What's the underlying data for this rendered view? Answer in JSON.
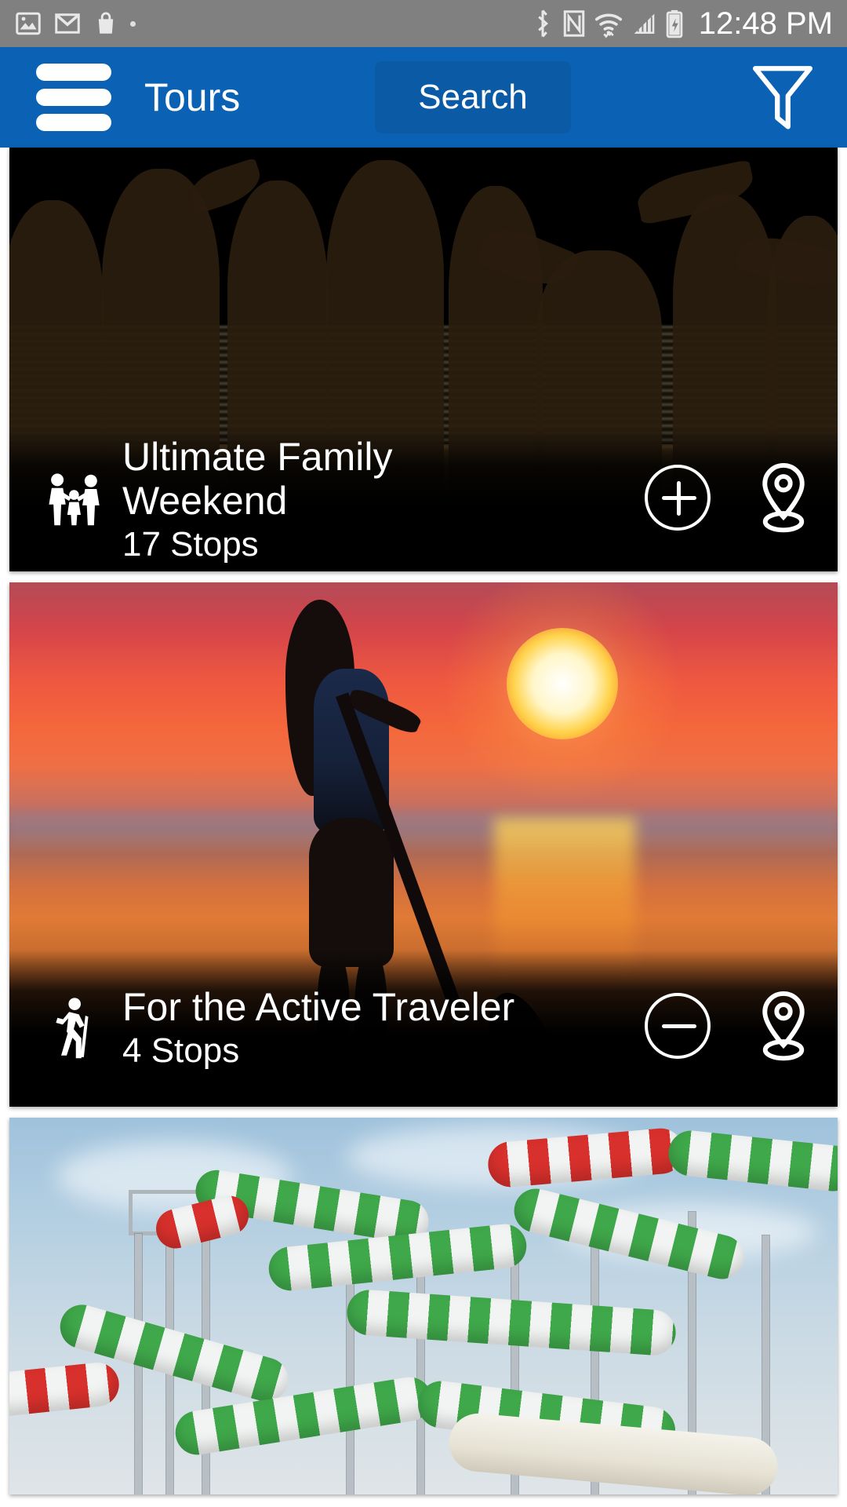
{
  "status_bar": {
    "background": "#808080",
    "left_icons": [
      "image-icon",
      "gmail-icon",
      "shopping-bag-icon",
      "dot-icon"
    ],
    "right_icons": [
      "bluetooth-icon",
      "nfc-icon",
      "wifi-icon",
      "cellular-signal-icon",
      "battery-charging-icon"
    ],
    "clock": "12:48 PM"
  },
  "header": {
    "background": "#0B62B5",
    "menu_icon": "hamburger-menu-icon",
    "title": "Tours",
    "search_label": "Search",
    "search_background": "#0A5AA6",
    "filter_icon": "funnel-filter-icon"
  },
  "cards": [
    {
      "title": "Ultimate Family Weekend",
      "stops": "17 Stops",
      "type_icon": "family-icon",
      "action_icon": "plus-circle-icon",
      "map_icon": "map-pin-icon",
      "photo": "beach-sunset-silhouettes-photo"
    },
    {
      "title": "For the Active Traveler",
      "stops": "4 Stops",
      "type_icon": "hiker-icon",
      "action_icon": "minus-circle-icon",
      "map_icon": "map-pin-icon",
      "photo": "paddleboarder-sunset-photo"
    },
    {
      "title": "",
      "stops": "",
      "type_icon": "",
      "action_icon": "",
      "map_icon": "",
      "photo": "water-slide-photo"
    }
  ]
}
